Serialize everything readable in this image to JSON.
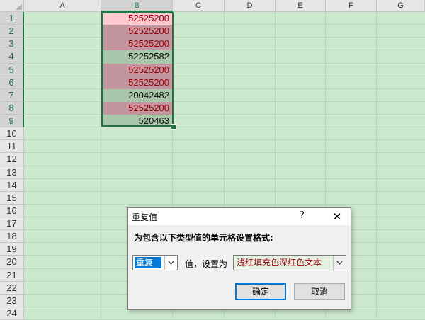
{
  "sheet": {
    "columns": [
      "A",
      "B",
      "C",
      "D",
      "E",
      "F",
      "G"
    ],
    "selected_column": "B",
    "rows": [
      "1",
      "2",
      "3",
      "4",
      "5",
      "6",
      "7",
      "8",
      "9",
      "10",
      "11",
      "12",
      "13",
      "14",
      "15",
      "16",
      "17",
      "18",
      "19",
      "20",
      "21",
      "22",
      "23",
      "24"
    ],
    "cells_B": [
      {
        "value": "52525200",
        "kind": "dup-active"
      },
      {
        "value": "52525200",
        "kind": "dup"
      },
      {
        "value": "52525200",
        "kind": "dup"
      },
      {
        "value": "52252582",
        "kind": "uniq"
      },
      {
        "value": "52525200",
        "kind": "dup"
      },
      {
        "value": "52525200",
        "kind": "dup"
      },
      {
        "value": "20042482",
        "kind": "uniq"
      },
      {
        "value": "52525200",
        "kind": "dup"
      },
      {
        "value": "520463",
        "kind": "uniq"
      }
    ],
    "colors": {
      "background": "#cce8cf",
      "duplicate_fill": "#ffc7ce",
      "duplicate_text": "#9c0006",
      "selection": "#217346"
    }
  },
  "dialog": {
    "title": "重复值",
    "help": "?",
    "close": "✕",
    "prompt": "为包含以下类型值的单元格设置格式:",
    "type_value": "重复",
    "mid_label": "值，设置为",
    "format_value": "浅红填充色深红色文本",
    "ok_label": "确定",
    "cancel_label": "取消"
  }
}
